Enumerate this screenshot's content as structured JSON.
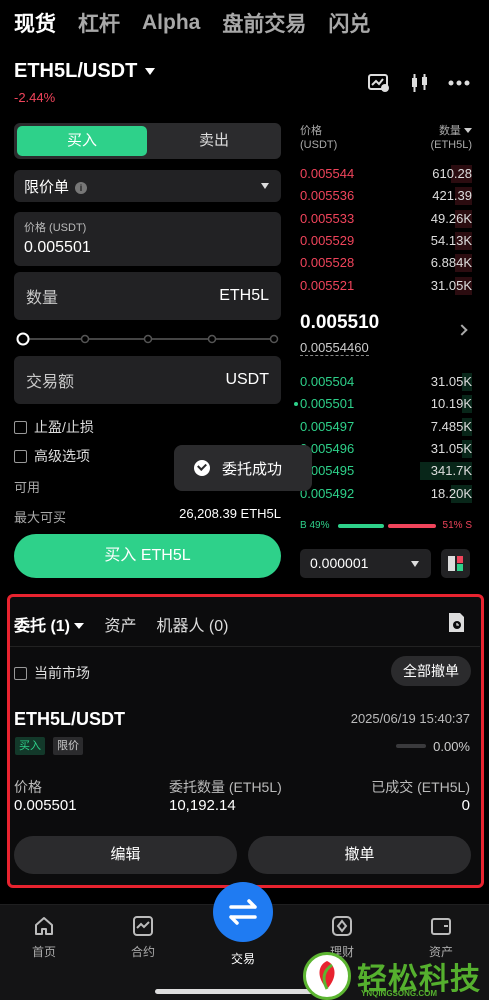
{
  "top_tabs": [
    "现货",
    "杠杆",
    "Alpha",
    "盘前交易",
    "闪兑"
  ],
  "pair": "ETH5L/USDT",
  "change": "-2.44%",
  "side": {
    "buy": "买入",
    "sell": "卖出"
  },
  "order_type": "限价单",
  "price": {
    "label": "价格 (USDT)",
    "value": "0.005501"
  },
  "quantity": {
    "label": "数量",
    "unit": "ETH5L"
  },
  "amount": {
    "label": "交易额",
    "unit": "USDT"
  },
  "tpsl": "止盈/止损",
  "advanced": "高级选项",
  "available_label": "可用",
  "max_buy_label": "最大可买",
  "max_buy_value": "26,208.39 ETH5L",
  "buy_button": "买入 ETH5L",
  "toast": "委托成功",
  "orderbook": {
    "price_header": "价格",
    "price_unit": "(USDT)",
    "qty_header": "数量",
    "qty_unit": "(ETH5L)",
    "asks": [
      {
        "price": "0.005544",
        "qty": "610.28",
        "depth": 0.12
      },
      {
        "price": "0.005536",
        "qty": "421.39",
        "depth": 0.1
      },
      {
        "price": "0.005533",
        "qty": "49.26K",
        "depth": 0.1
      },
      {
        "price": "0.005529",
        "qty": "54.13K",
        "depth": 0.1
      },
      {
        "price": "0.005528",
        "qty": "6.884K",
        "depth": 0.1
      },
      {
        "price": "0.005521",
        "qty": "31.05K",
        "depth": 0.1
      }
    ],
    "last_price": "0.005510",
    "mark_price": "0.00554460",
    "bids": [
      {
        "price": "0.005504",
        "qty": "31.05K",
        "depth": 0.06
      },
      {
        "price": "0.005501",
        "qty": "10.19K",
        "depth": 0.06
      },
      {
        "price": "0.005497",
        "qty": "7.485K",
        "depth": 0.06
      },
      {
        "price": "0.005496",
        "qty": "31.05K",
        "depth": 0.06
      },
      {
        "price": "0.005495",
        "qty": "341.7K",
        "depth": 0.3
      },
      {
        "price": "0.005492",
        "qty": "18.20K",
        "depth": 0.12
      }
    ],
    "buy_ratio": "B 49%",
    "sell_ratio": "51% S",
    "precision": "0.000001"
  },
  "orders_panel": {
    "tabs": [
      "委托 (1)",
      "资产",
      "机器人 (0)"
    ],
    "current_market": "当前市场",
    "cancel_all": "全部撤单",
    "order": {
      "pair": "ETH5L/USDT",
      "time": "2025/06/19 15:40:37",
      "tag_side": "买入",
      "tag_type": "限价",
      "filled_pct": "0.00%",
      "price_label": "价格",
      "price_value": "0.005501",
      "qty_label": "委托数量 (ETH5L)",
      "qty_value": "10,192.14",
      "filled_label": "已成交 (ETH5L)",
      "filled_value": "0",
      "edit": "编辑",
      "cancel": "撤单"
    }
  },
  "nav": [
    "首页",
    "合约",
    "交易",
    "理财",
    "资产"
  ],
  "watermark": {
    "text": "轻松科技",
    "sub": "YNQINGSONG.COM"
  },
  "colors": {
    "green": "#2ed18a",
    "red": "#f0445b",
    "blue": "#1f7bf2",
    "highlight": "#e8232f"
  }
}
